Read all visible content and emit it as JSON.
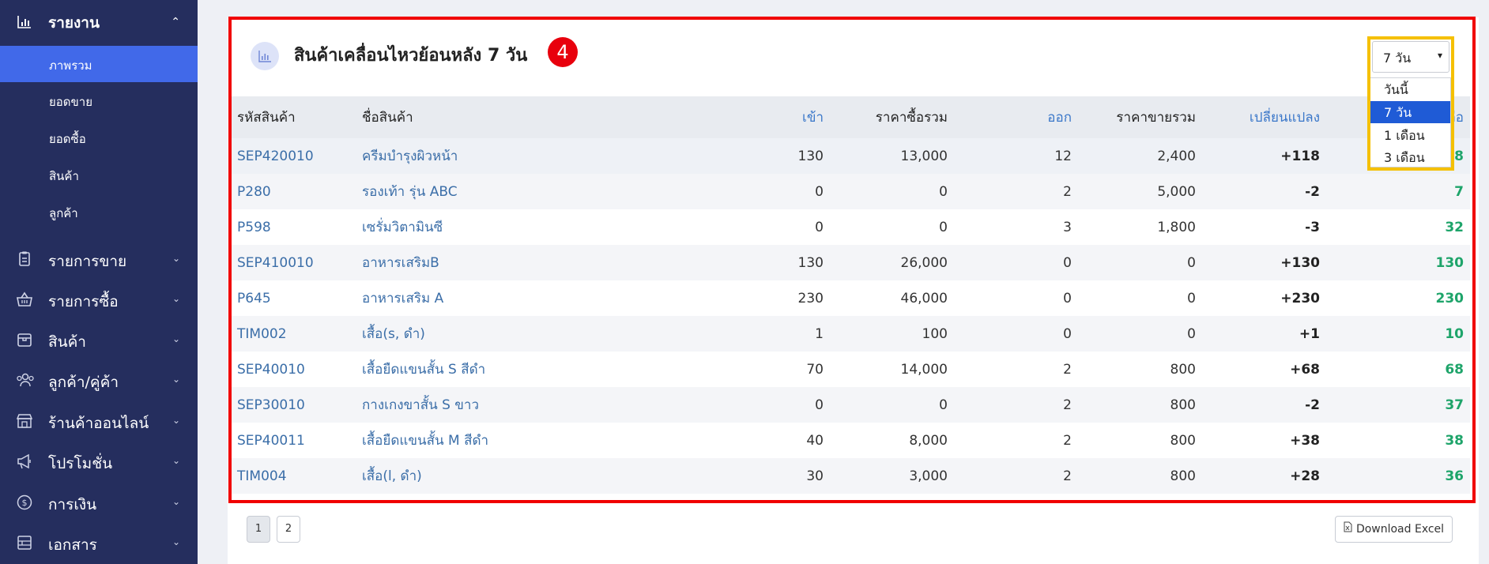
{
  "sidebar": {
    "section_title": "รายงาน",
    "sub_items": [
      {
        "label": "ภาพรวม"
      },
      {
        "label": "ยอดขาย"
      },
      {
        "label": "ยอดซื้อ"
      },
      {
        "label": "สินค้า"
      },
      {
        "label": "ลูกค้า"
      }
    ],
    "menu_items": [
      {
        "label": "รายการขาย",
        "icon": "clipboard-icon"
      },
      {
        "label": "รายการซื้อ",
        "icon": "basket-icon"
      },
      {
        "label": "สินค้า",
        "icon": "box-icon"
      },
      {
        "label": "ลูกค้า/คู่ค้า",
        "icon": "users-icon"
      },
      {
        "label": "ร้านค้าออนไลน์",
        "icon": "store-icon"
      },
      {
        "label": "โปรโมชั่น",
        "icon": "megaphone-icon"
      },
      {
        "label": "การเงิน",
        "icon": "dollar-icon"
      },
      {
        "label": "เอกสาร",
        "icon": "document-icon"
      }
    ]
  },
  "card": {
    "title": "สินค้าเคลื่อนไหวย้อนหลัง 7 วัน",
    "step_badge": "4"
  },
  "period_select": {
    "value": "7 วัน",
    "options": [
      "วันนี้",
      "7 วัน",
      "1 เดือน",
      "3 เดือน"
    ],
    "selected_index": 1
  },
  "table": {
    "headers": [
      "รหัสสินค้า",
      "ชื่อสินค้า",
      "เข้า",
      "ราคาซื้อรวม",
      "ออก",
      "ราคาขายรวม",
      "เปลี่ยนแปลง",
      "คงเหลือ"
    ],
    "rows": [
      [
        "SEP420010",
        "ครีมบำรุงผิวหน้า",
        "130",
        "13,000",
        "12",
        "2,400",
        "+118",
        "118"
      ],
      [
        "P280",
        "รองเท้า รุ่น ABC",
        "0",
        "0",
        "2",
        "5,000",
        "-2",
        "7"
      ],
      [
        "P598",
        "เซรั่มวิตามินซี",
        "0",
        "0",
        "3",
        "1,800",
        "-3",
        "32"
      ],
      [
        "SEP410010",
        "อาหารเสริมB",
        "130",
        "26,000",
        "0",
        "0",
        "+130",
        "130"
      ],
      [
        "P645",
        "อาหารเสริม A",
        "230",
        "46,000",
        "0",
        "0",
        "+230",
        "230"
      ],
      [
        "TIM002",
        "เสื้อ(s, ดำ)",
        "1",
        "100",
        "0",
        "0",
        "+1",
        "10"
      ],
      [
        "SEP40010",
        "เสื้อยืดแขนสั้น S สีดำ",
        "70",
        "14,000",
        "2",
        "800",
        "+68",
        "68"
      ],
      [
        "SEP30010",
        "กางเกงขาสั้น S ขาว",
        "0",
        "0",
        "2",
        "800",
        "-2",
        "37"
      ],
      [
        "SEP40011",
        "เสื้อยืดแขนสั้น M สีดำ",
        "40",
        "8,000",
        "2",
        "800",
        "+38",
        "38"
      ],
      [
        "TIM004",
        "เสื้อ(l, ดำ)",
        "30",
        "3,000",
        "2",
        "800",
        "+28",
        "36"
      ]
    ]
  },
  "pagination": {
    "pages": [
      "1",
      "2"
    ],
    "current": "1"
  },
  "download_label": "Download Excel",
  "colors": {
    "sidebar_bg": "#252e5e",
    "active_item": "#4169e9",
    "highlight_red": "#f00000",
    "highlight_yellow": "#f5c000",
    "link": "#3b6ea8",
    "positive_green": "#1ea46a"
  }
}
